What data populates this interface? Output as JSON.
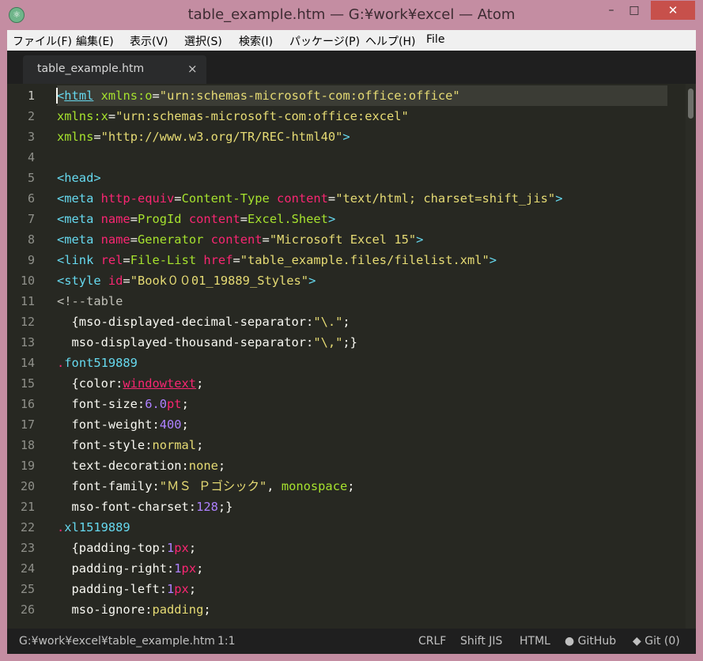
{
  "window": {
    "title": "table_example.htm — G:¥work¥excel — Atom",
    "icon": "atom-icon",
    "controls": {
      "minimize": "–",
      "maximize": "□",
      "close": "✕"
    }
  },
  "menu": [
    "ファイル(F)",
    "編集(E)",
    "表示(V)",
    "選択(S)",
    "検索(I)",
    "パッケージ(P)",
    "ヘルプ(H)",
    "File"
  ],
  "tab": {
    "title": "table_example.htm",
    "close": "×"
  },
  "line_numbers": [
    "1",
    "2",
    "3",
    "4",
    "5",
    "6",
    "7",
    "8",
    "9",
    "10",
    "11",
    "12",
    "13",
    "14",
    "15",
    "16",
    "17",
    "18",
    "19",
    "20",
    "21",
    "22",
    "23",
    "24",
    "25",
    "26"
  ],
  "code": [
    [
      [
        "<",
        "t-ent"
      ],
      [
        "html",
        "t-html"
      ],
      [
        " ",
        ""
      ],
      [
        "xmlns:o",
        "t-attr"
      ],
      [
        "=",
        "t-prop"
      ],
      [
        "\"urn:schemas-microsoft-com:office:office\"",
        "t-str"
      ]
    ],
    [
      [
        "xmlns:x",
        "t-attr"
      ],
      [
        "=",
        "t-prop"
      ],
      [
        "\"urn:schemas-microsoft-com:office:excel\"",
        "t-str"
      ]
    ],
    [
      [
        "xmlns",
        "t-attr"
      ],
      [
        "=",
        "t-prop"
      ],
      [
        "\"http://www.w3.org/TR/REC-html40\"",
        "t-str"
      ],
      [
        ">",
        "t-ent"
      ]
    ],
    [],
    [
      [
        "<head>",
        "t-ent"
      ]
    ],
    [
      [
        "<meta ",
        "t-ent"
      ],
      [
        "http-equiv",
        "t-tag"
      ],
      [
        "=",
        "t-prop"
      ],
      [
        "Content-Type",
        "t-attr"
      ],
      [
        " ",
        ""
      ],
      [
        "content",
        "t-tag"
      ],
      [
        "=",
        "t-prop"
      ],
      [
        "\"text/html; charset=shift_jis\"",
        "t-str"
      ],
      [
        ">",
        "t-ent"
      ]
    ],
    [
      [
        "<meta ",
        "t-ent"
      ],
      [
        "name",
        "t-tag"
      ],
      [
        "=",
        "t-prop"
      ],
      [
        "ProgId",
        "t-attr"
      ],
      [
        " ",
        ""
      ],
      [
        "content",
        "t-tag"
      ],
      [
        "=",
        "t-prop"
      ],
      [
        "Excel.Sheet",
        "t-attr"
      ],
      [
        ">",
        "t-ent"
      ]
    ],
    [
      [
        "<meta ",
        "t-ent"
      ],
      [
        "name",
        "t-tag"
      ],
      [
        "=",
        "t-prop"
      ],
      [
        "Generator",
        "t-attr"
      ],
      [
        " ",
        ""
      ],
      [
        "content",
        "t-tag"
      ],
      [
        "=",
        "t-prop"
      ],
      [
        "\"Microsoft Excel 15\"",
        "t-str"
      ],
      [
        ">",
        "t-ent"
      ]
    ],
    [
      [
        "<link ",
        "t-ent"
      ],
      [
        "rel",
        "t-tag"
      ],
      [
        "=",
        "t-prop"
      ],
      [
        "File-List",
        "t-attr"
      ],
      [
        " ",
        ""
      ],
      [
        "href",
        "t-tag"
      ],
      [
        "=",
        "t-prop"
      ],
      [
        "\"table_example.files/filelist.xml\"",
        "t-str"
      ],
      [
        ">",
        "t-ent"
      ]
    ],
    [
      [
        "<style ",
        "t-ent"
      ],
      [
        "id",
        "t-tag"
      ],
      [
        "=",
        "t-prop"
      ],
      [
        "\"Book００01_19889_Styles\"",
        "t-str"
      ],
      [
        ">",
        "t-ent"
      ]
    ],
    [
      [
        "<!--table",
        "t-cmt"
      ]
    ],
    [
      [
        "  {mso-displayed-decimal-separator:",
        "t-prop"
      ],
      [
        "\"\\.\"",
        "t-str"
      ],
      [
        ";",
        "t-prop"
      ]
    ],
    [
      [
        "  mso-displayed-thousand-separator:",
        "t-prop"
      ],
      [
        "\"\\,\"",
        "t-str"
      ],
      [
        ";}",
        "t-prop"
      ]
    ],
    [
      [
        ".",
        "t-dot"
      ],
      [
        "font519889",
        "t-sel"
      ]
    ],
    [
      [
        "  {color:",
        "t-prop"
      ],
      [
        "windowtext",
        "t-pink-under"
      ],
      [
        ";",
        "t-prop"
      ]
    ],
    [
      [
        "  font-size:",
        "t-prop"
      ],
      [
        "6.0",
        "t-num"
      ],
      [
        "pt",
        "t-tag"
      ],
      [
        ";",
        "t-prop"
      ]
    ],
    [
      [
        "  font-weight:",
        "t-prop"
      ],
      [
        "400",
        "t-num"
      ],
      [
        ";",
        "t-prop"
      ]
    ],
    [
      [
        "  font-style:",
        "t-prop"
      ],
      [
        "normal",
        "t-val"
      ],
      [
        ";",
        "t-prop"
      ]
    ],
    [
      [
        "  text-decoration:",
        "t-prop"
      ],
      [
        "none",
        "t-val"
      ],
      [
        ";",
        "t-prop"
      ]
    ],
    [
      [
        "  font-family:",
        "t-prop"
      ],
      [
        "\"ＭＳ Ｐゴシック\"",
        "t-str"
      ],
      [
        ", ",
        "t-prop"
      ],
      [
        "monospace",
        "t-mono"
      ],
      [
        ";",
        "t-prop"
      ]
    ],
    [
      [
        "  mso-font-charset:",
        "t-prop"
      ],
      [
        "128",
        "t-num"
      ],
      [
        ";}",
        "t-prop"
      ]
    ],
    [
      [
        ".",
        "t-dot"
      ],
      [
        "xl1519889",
        "t-sel"
      ]
    ],
    [
      [
        "  {padding-top:",
        "t-prop"
      ],
      [
        "1",
        "t-num"
      ],
      [
        "px",
        "t-tag"
      ],
      [
        ";",
        "t-prop"
      ]
    ],
    [
      [
        "  padding-right:",
        "t-prop"
      ],
      [
        "1",
        "t-num"
      ],
      [
        "px",
        "t-tag"
      ],
      [
        ";",
        "t-prop"
      ]
    ],
    [
      [
        "  padding-left:",
        "t-prop"
      ],
      [
        "1",
        "t-num"
      ],
      [
        "px",
        "t-tag"
      ],
      [
        ";",
        "t-prop"
      ]
    ],
    [
      [
        "  mso-ignore:",
        "t-prop"
      ],
      [
        "padding",
        "t-val"
      ],
      [
        ";",
        "t-prop"
      ]
    ]
  ],
  "status": {
    "path": "G:¥work¥excel¥table_example.htm",
    "cursor": "1:1",
    "line_ending": "CRLF",
    "encoding": "Shift JIS",
    "grammar": "HTML",
    "github": "GitHub",
    "git": "Git (0)"
  }
}
